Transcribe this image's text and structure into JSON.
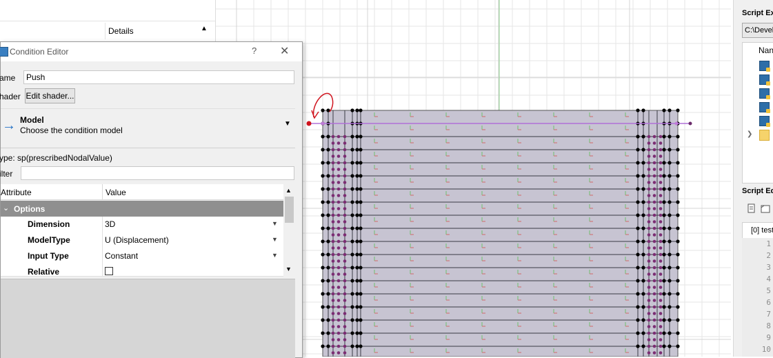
{
  "left_panel": {
    "details_header": "Details"
  },
  "dialog": {
    "title": "Condition Editor",
    "help": "?",
    "close": "✕",
    "name_label": "ame",
    "name_value": "Push",
    "shader_label": "hader",
    "shader_button": "Edit shader...",
    "model": {
      "title": "Model",
      "subtitle": "Choose the condition model"
    },
    "type_text": "ype:  sp(prescribedNodalValue)",
    "filter_label": "ilter",
    "grid": {
      "col_attribute": "Attribute",
      "col_value": "Value",
      "group": "Options",
      "rows": [
        {
          "attribute": "Dimension",
          "value": "3D"
        },
        {
          "attribute": "ModelType",
          "value": "U (Displacement)"
        },
        {
          "attribute": "Input Type",
          "value": "Constant"
        },
        {
          "attribute": "Relative",
          "value": ""
        }
      ]
    }
  },
  "right_panel": {
    "explorer_title": "Script Ex",
    "path_value": "C:\\Devel",
    "tree_header": "Nan",
    "editor_title": "Script Ed",
    "tab_label": "[0] test",
    "line_numbers": [
      "1",
      "2",
      "3",
      "4",
      "5",
      "6",
      "7",
      "8",
      "9",
      "10"
    ]
  },
  "colors": {
    "mesh_fill": "#c7c4d2",
    "node": "#000000",
    "node_dense": "#7b2d73",
    "selection_line": "#b070d8",
    "red_point": "#d0141e",
    "grid_line": "#e6e6e6",
    "axis_green": "#8fcf8f"
  }
}
